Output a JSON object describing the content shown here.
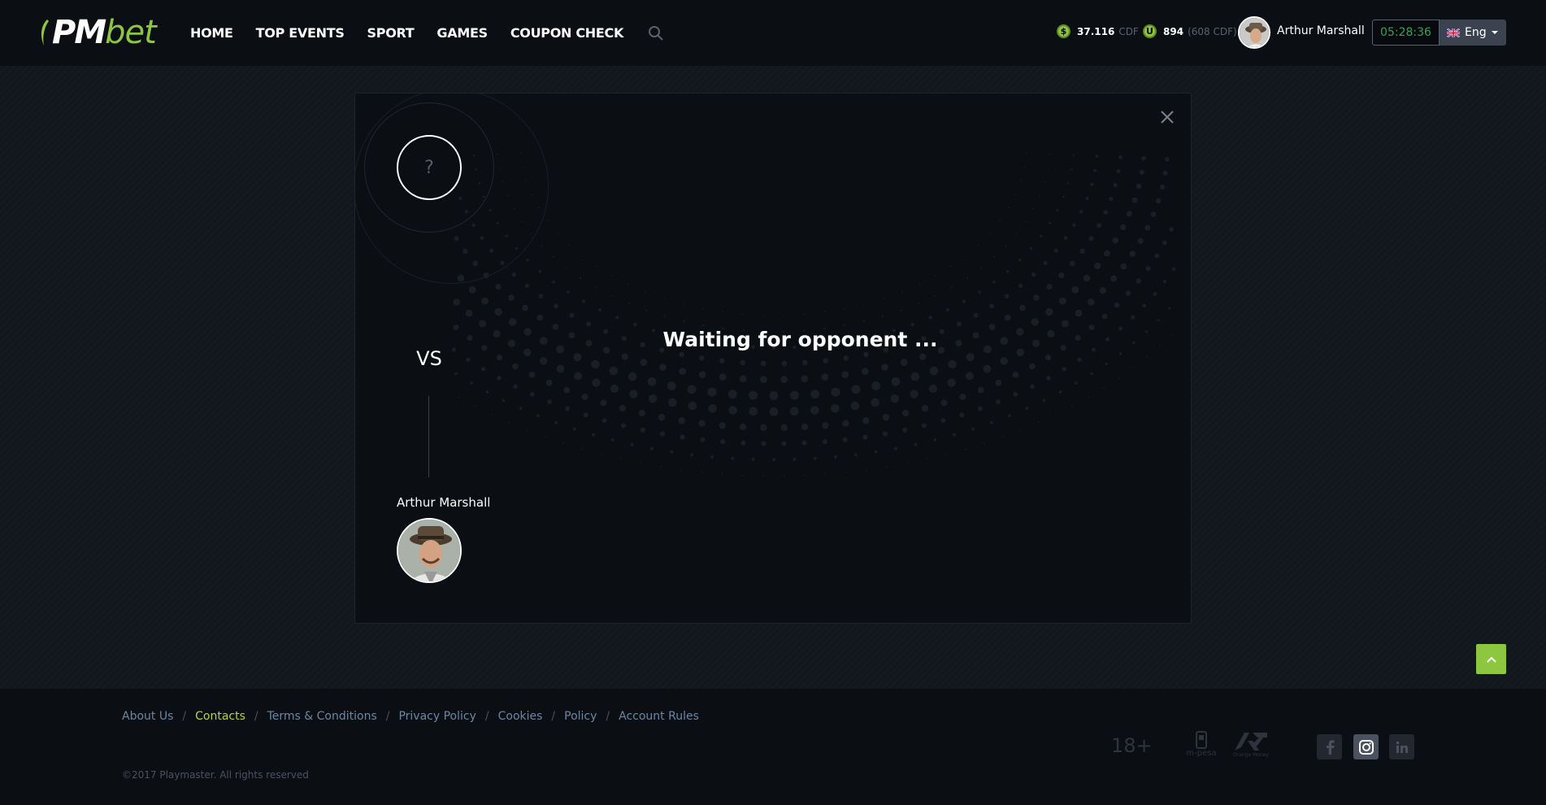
{
  "header": {
    "logo": {
      "pm": "PM",
      "bet": "bet"
    },
    "nav": [
      "HOME",
      "TOP EVENTS",
      "SPORT",
      "GAMES",
      "COUPON CHECK"
    ],
    "balances": [
      {
        "icon": "dollar-coin-icon",
        "value": "37.116",
        "unit": "CDF"
      },
      {
        "icon": "bonus-coin-icon",
        "value": "894",
        "unit": "(608 CDF)"
      }
    ],
    "user_name": "Arthur Marshall",
    "timer": "05:28:36",
    "language": "Eng"
  },
  "modal": {
    "opponent_placeholder": "?",
    "vs": "VS",
    "player_name": "Arthur Marshall",
    "status": "Waiting for opponent ..."
  },
  "footer": {
    "links": [
      "About Us",
      "Contacts",
      "Terms & Conditions",
      "Privacy Policy",
      "Cookies",
      "Policy",
      "Account Rules"
    ],
    "active_link": "Contacts",
    "copyright": "©2017 Playmaster. All rights reserved",
    "age": "18+",
    "payments": [
      "m-pesa",
      "Orange Money"
    ],
    "social": [
      "facebook-icon",
      "instagram-icon",
      "linkedin-icon"
    ]
  },
  "colors": {
    "accent": "#8dc63f",
    "background": "#12161c",
    "header": "#0b0e13",
    "link": "#6b87a6",
    "active_link": "#b9d33a",
    "timer_text": "#2fa55a"
  }
}
